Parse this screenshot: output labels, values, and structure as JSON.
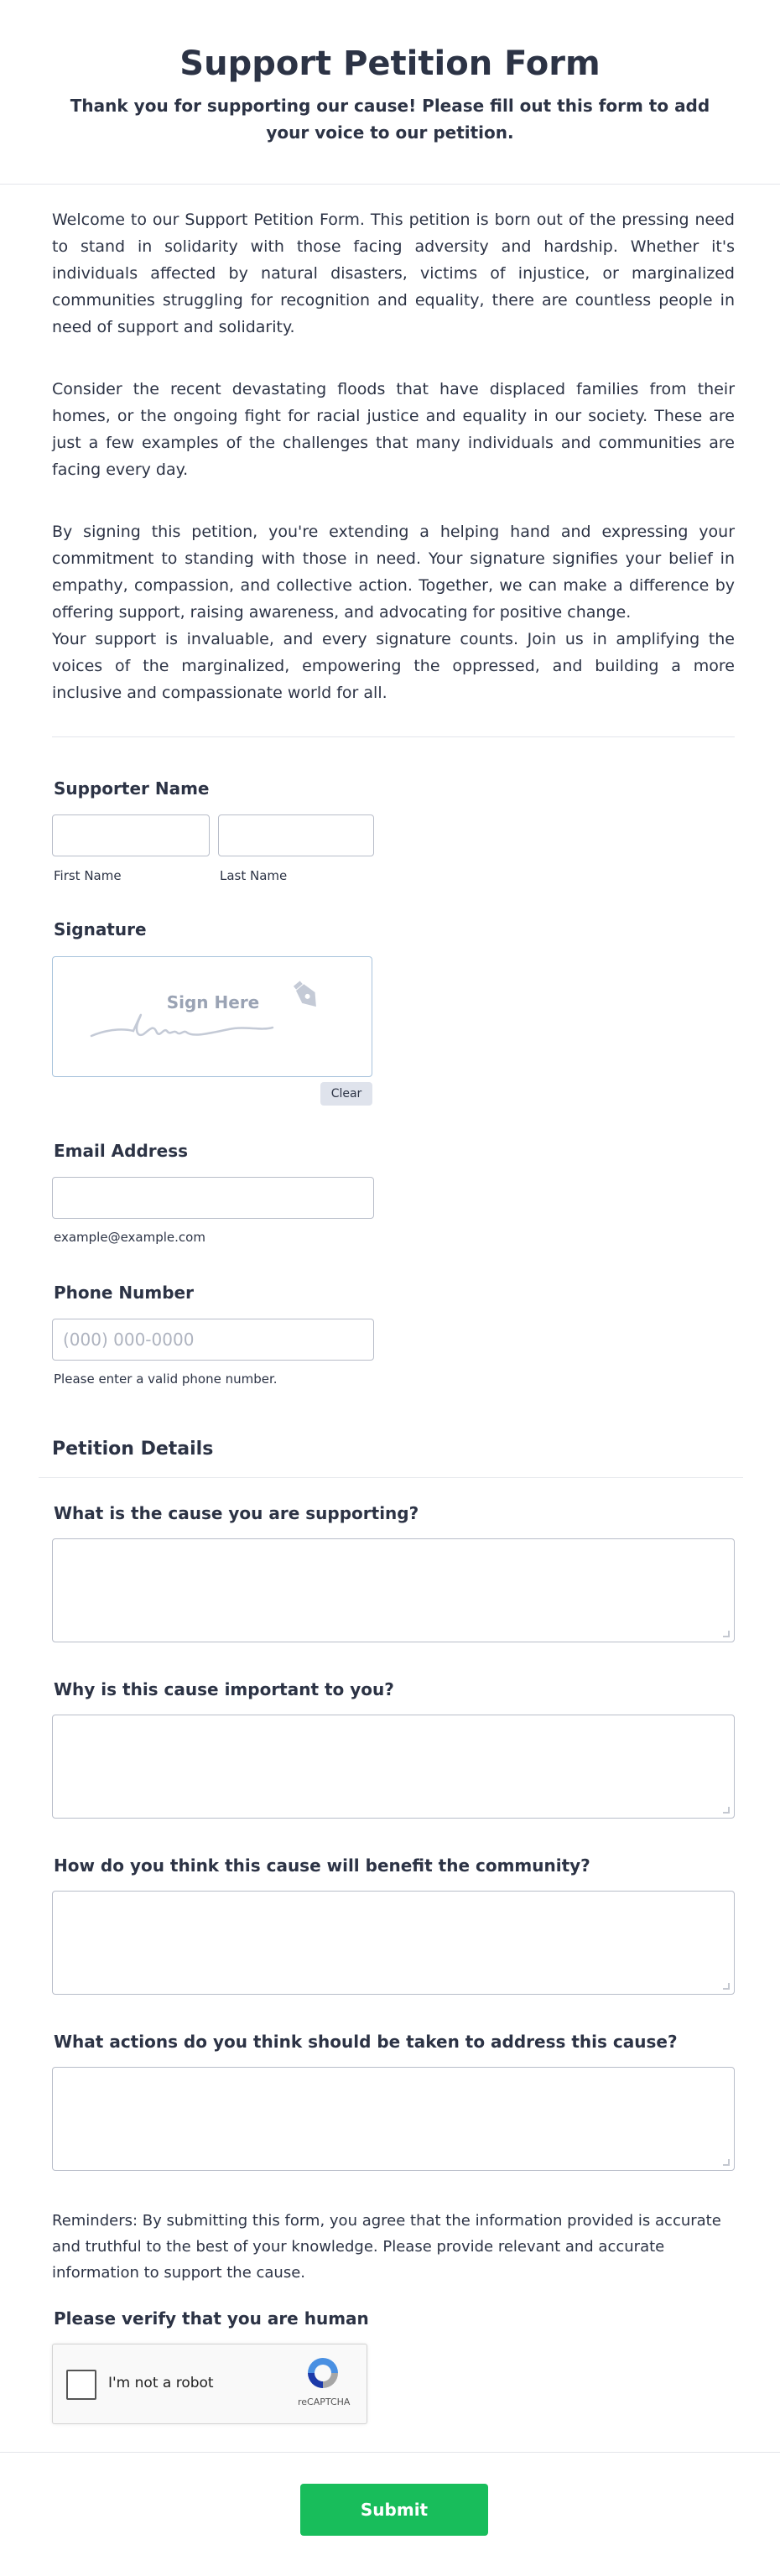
{
  "header": {
    "title": "Support Petition Form",
    "subtitle": "Thank you for supporting our cause! Please fill out this form to add your voice to our petition."
  },
  "intro": {
    "p1": "Welcome to our Support Petition Form. This petition is born out of the pressing need to stand in solidarity with those facing adversity and hardship. Whether it's individuals affected by natural disasters, victims of injustice, or marginalized communities struggling for recognition and equality, there are countless people in need of support and solidarity.",
    "p2": "Consider the recent devastating floods that have displaced families from their homes, or the ongoing fight for racial justice and equality in our society. These are just a few examples of the challenges that many individuals and communities are facing every day.",
    "p3": "By signing this petition, you're extending a helping hand and expressing your commitment to standing with those in need. Your signature signifies your belief in empathy, compassion, and collective action. Together, we can make a difference by offering support, raising awareness, and advocating for positive change.",
    "p4": "Your support is invaluable, and every signature counts. Join us in amplifying the voices of the marginalized, empowering the oppressed, and building a more inclusive and compassionate world for all."
  },
  "supporter_name": {
    "label": "Supporter Name",
    "first_value": "",
    "last_value": "",
    "first_sublabel": "First Name",
    "last_sublabel": "Last Name"
  },
  "signature": {
    "label": "Signature",
    "placeholder": "Sign Here",
    "clear_label": "Clear"
  },
  "email": {
    "label": "Email Address",
    "value": "",
    "sublabel": "example@example.com"
  },
  "phone": {
    "label": "Phone Number",
    "value": "",
    "placeholder": "(000) 000-0000",
    "sublabel": "Please enter a valid phone number."
  },
  "details": {
    "title": "Petition Details",
    "q1": "What is the cause you are supporting?",
    "q2": "Why is this cause important to you?",
    "q3": "How do you think this cause will benefit the community?",
    "q4": "What actions do you think should be taken to address this cause?"
  },
  "reminder": "Reminders: By submitting this form, you agree that the information provided is accurate and truthful to the best of your knowledge. Please provide relevant and accurate information to support the cause.",
  "captcha": {
    "label": "Please verify that you are human",
    "checkbox_label": "I'm not a robot",
    "brand": "reCAPTCHA"
  },
  "submit_label": "Submit",
  "colors": {
    "submit": "#18bd5b",
    "text": "#2c3345",
    "border": "#b8bdc9"
  }
}
